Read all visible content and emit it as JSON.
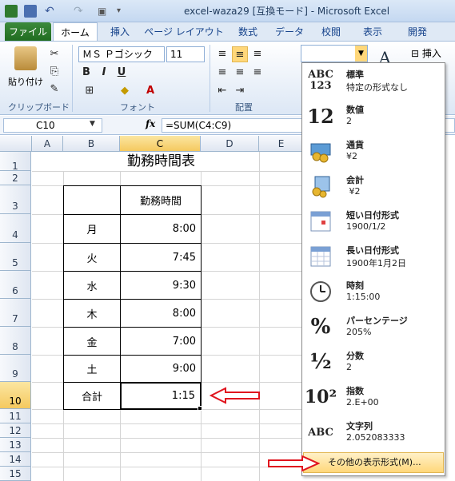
{
  "titlebar": {
    "title": "excel-waza29  [互換モード] - Microsoft Excel"
  },
  "tabs": {
    "file": "ファイル",
    "home": "ホーム",
    "insert": "挿入",
    "page_layout": "ページ レイアウト",
    "formulas": "数式",
    "data": "データ",
    "review": "校閲",
    "view": "表示",
    "developer": "開発"
  },
  "ribbon": {
    "paste": "貼り付け",
    "font_name": "ＭＳ Ｐゴシック",
    "font_size": "11",
    "insert_btn": "挿入",
    "groups": {
      "clipboard": "クリップボード",
      "font": "フォント",
      "alignment": "配置"
    }
  },
  "formula_bar": {
    "name_box": "C10",
    "fx": "fx",
    "formula": "=SUM(C4:C9)"
  },
  "sheet": {
    "columns": [
      "A",
      "B",
      "C",
      "D",
      "E"
    ],
    "rows": [
      "1",
      "2",
      "3",
      "4",
      "5",
      "6",
      "7",
      "8",
      "9",
      "10",
      "11",
      "12",
      "13",
      "14",
      "15"
    ],
    "title": "勤務時間表",
    "header": "勤務時間",
    "days": [
      "月",
      "火",
      "水",
      "木",
      "金",
      "土"
    ],
    "times": [
      "8:00",
      "7:45",
      "9:30",
      "8:00",
      "7:00",
      "9:00"
    ],
    "total_label": "合計",
    "total_value": "1:15"
  },
  "number_formats": [
    {
      "icon": "ABC\n123",
      "name": "標準",
      "sample": "特定の形式なし"
    },
    {
      "icon": "12",
      "name": "数値",
      "sample": "2"
    },
    {
      "icon": "currency-icon",
      "name": "通貨",
      "sample": "¥2"
    },
    {
      "icon": "accounting-icon",
      "name": "会計",
      "sample": " ¥2"
    },
    {
      "icon": "calendar-icon",
      "name": "短い日付形式",
      "sample": "1900/1/2"
    },
    {
      "icon": "calendar-icon",
      "name": "長い日付形式",
      "sample": "1900年1月2日"
    },
    {
      "icon": "clock-icon",
      "name": "時刻",
      "sample": "1:15:00"
    },
    {
      "icon": "%",
      "name": "パーセンテージ",
      "sample": "205%"
    },
    {
      "icon": "½",
      "name": "分数",
      "sample": "2"
    },
    {
      "icon": "10²",
      "name": "指数",
      "sample": "2.E+00"
    },
    {
      "icon": "ABC",
      "name": "文字列",
      "sample": "2.052083333"
    }
  ],
  "more_formats": "その他の表示形式(M)...",
  "colors": {
    "arrow_red": "#e0141e",
    "selected_header": "#f5c95f",
    "file_tab": "#2a7a2a"
  }
}
